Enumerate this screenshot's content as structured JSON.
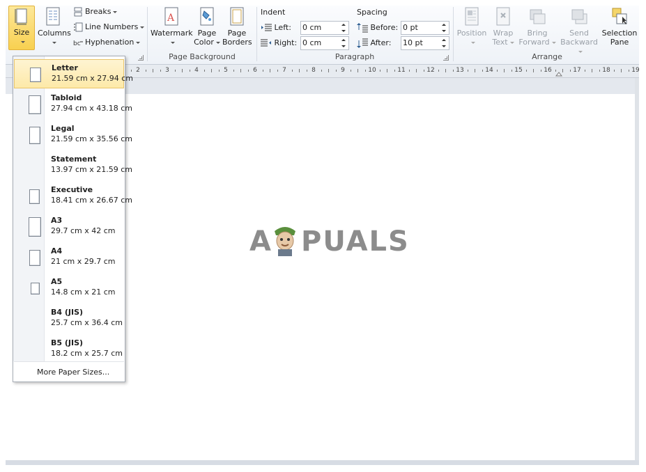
{
  "ribbon": {
    "page_setup": {
      "size_label": "Size",
      "columns_label": "Columns",
      "breaks_label": "Breaks",
      "line_numbers_label": "Line Numbers",
      "hyphenation_label": "Hyphenation"
    },
    "page_background": {
      "group_label": "Page Background",
      "watermark_label": "Watermark",
      "page_color_line1": "Page",
      "page_color_line2": "Color",
      "page_borders_line1": "Page",
      "page_borders_line2": "Borders"
    },
    "paragraph": {
      "group_label": "Paragraph",
      "indent_heading": "Indent",
      "left_label": "Left:",
      "left_value": "0 cm",
      "right_label": "Right:",
      "right_value": "0 cm",
      "spacing_heading": "Spacing",
      "before_label": "Before:",
      "before_value": "0 pt",
      "after_label": "After:",
      "after_value": "10 pt"
    },
    "arrange": {
      "group_label": "Arrange",
      "position_label": "Position",
      "wrap_line1": "Wrap",
      "wrap_line2": "Text",
      "bring_line1": "Bring",
      "bring_line2": "Forward",
      "send_line1": "Send",
      "send_line2": "Backward",
      "selection_line1": "Selection",
      "selection_line2": "Pane"
    }
  },
  "ruler": {
    "numbers": [
      "2",
      "3",
      "4",
      "5",
      "6",
      "7",
      "8",
      "9",
      "10",
      "11",
      "12",
      "13",
      "14",
      "15",
      "16",
      "17",
      "18",
      "19"
    ]
  },
  "watermark": {
    "text_left": "A",
    "text_right": "PUALS"
  },
  "size_menu": {
    "items": [
      {
        "name": "Letter",
        "dims": "21.59 cm x 27.94 cm",
        "selected": true
      },
      {
        "name": "Tabloid",
        "dims": "27.94 cm x 43.18 cm"
      },
      {
        "name": "Legal",
        "dims": "21.59 cm x 35.56 cm"
      },
      {
        "name": "Statement",
        "dims": "13.97 cm x 21.59 cm"
      },
      {
        "name": "Executive",
        "dims": "18.41 cm x 26.67 cm"
      },
      {
        "name": "A3",
        "dims": "29.7 cm x 42 cm"
      },
      {
        "name": "A4",
        "dims": "21 cm x 29.7 cm"
      },
      {
        "name": "A5",
        "dims": "14.8 cm x 21 cm"
      },
      {
        "name": "B4 (JIS)",
        "dims": "25.7 cm x 36.4 cm"
      },
      {
        "name": "B5 (JIS)",
        "dims": "18.2 cm x 25.7 cm"
      }
    ],
    "more_label": "More Paper Sizes..."
  },
  "colors": {
    "selected_bg": "#fde9a8",
    "selected_border": "#e8c46a",
    "ribbon_bg": "#eef2f7"
  }
}
